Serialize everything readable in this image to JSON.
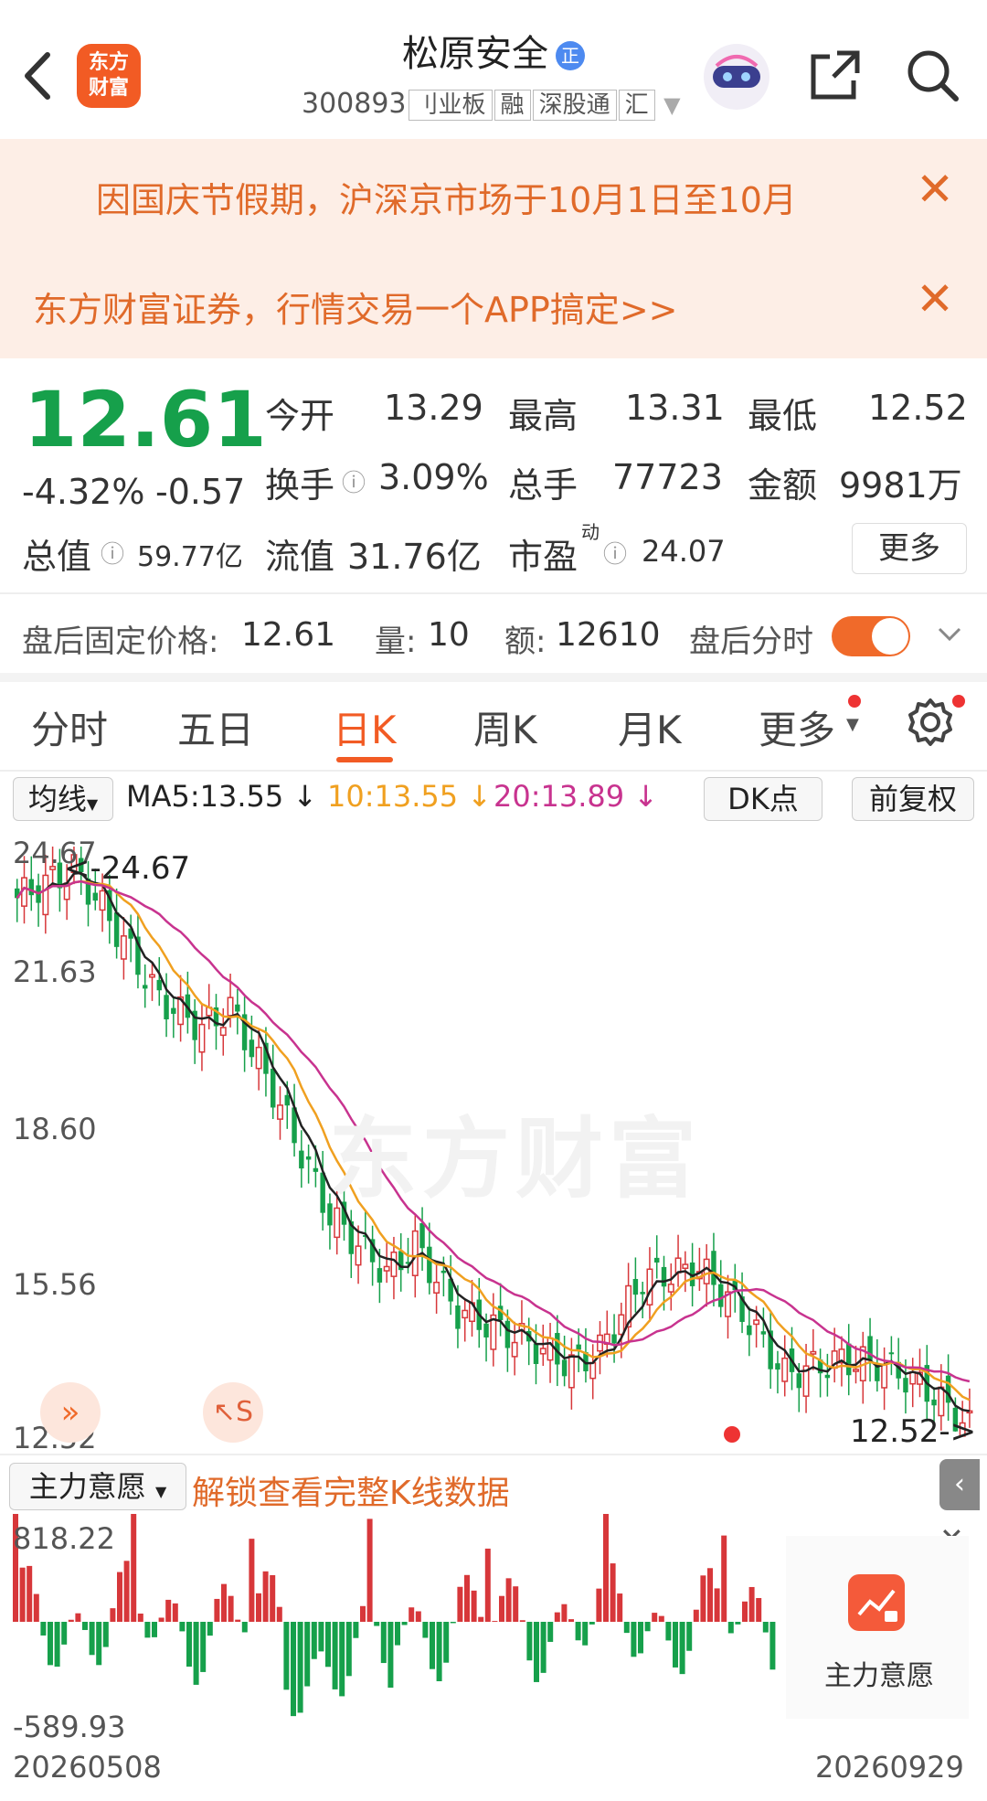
{
  "header": {
    "title": "松原安全",
    "badge": "正",
    "code": "300893",
    "tags": [
      "刂业板",
      "融",
      "深股通",
      "汇"
    ]
  },
  "logo": {
    "line1": "东方",
    "line2": "财富"
  },
  "notices": [
    {
      "text": "因国庆节假期，沪深京市场于10月1日至10月"
    },
    {
      "text": "东方财富证券，行情交易一个APP搞定>>"
    }
  ],
  "quote": {
    "price": "12.61",
    "change_pct": "-4.32%",
    "change": "-0.57",
    "open_label": "今开",
    "open": "13.29",
    "high_label": "最高",
    "high": "13.31",
    "low_label": "最低",
    "low": "12.52",
    "turnover_label": "换手",
    "turnover": "3.09%",
    "volume_label": "总手",
    "volume": "77723",
    "amount_label": "金额",
    "amount": "9981万",
    "mktcap_label": "总值",
    "mktcap": "59.77亿",
    "float_label": "流值",
    "float": "31.76亿",
    "pe_label": "市盈",
    "pe_sup": "动",
    "pe": "24.07",
    "more": "更多"
  },
  "afterhours": {
    "price_label": "盘后固定价格:",
    "price": "12.61",
    "vol_label": "量:",
    "vol": "10",
    "amt_label": "额:",
    "amt": "12610",
    "switch_label": "盘后分时"
  },
  "tabs": [
    "分时",
    "五日",
    "日K",
    "周K",
    "月K",
    "更多"
  ],
  "ma": {
    "selector": "均线",
    "ma5": "MA5:13.55 ↓",
    "ma10": "10:13.55 ↓",
    "ma20": "20:13.89 ↓",
    "dk": "DK点",
    "adjust": "前复权",
    "colors": {
      "ma5": "#222222",
      "ma10": "#f0a020",
      "ma20": "#c8338f"
    }
  },
  "kchart": {
    "y_labels": [
      "24.67",
      "21.63",
      "18.60",
      "15.56",
      "12.52"
    ],
    "max_marker": "24.67",
    "min_marker": "12.52->",
    "watermark": "东方财富",
    "up_color": "#d7373a",
    "down_color": "#16a04b"
  },
  "indicator": {
    "selector": "主力意愿",
    "unlock": "解锁查看完整K线数据",
    "y_max": "818.22",
    "y_min": "-589.93",
    "date_start": "20260508",
    "date_end": "20260929",
    "card_label": "主力意愿"
  }
}
